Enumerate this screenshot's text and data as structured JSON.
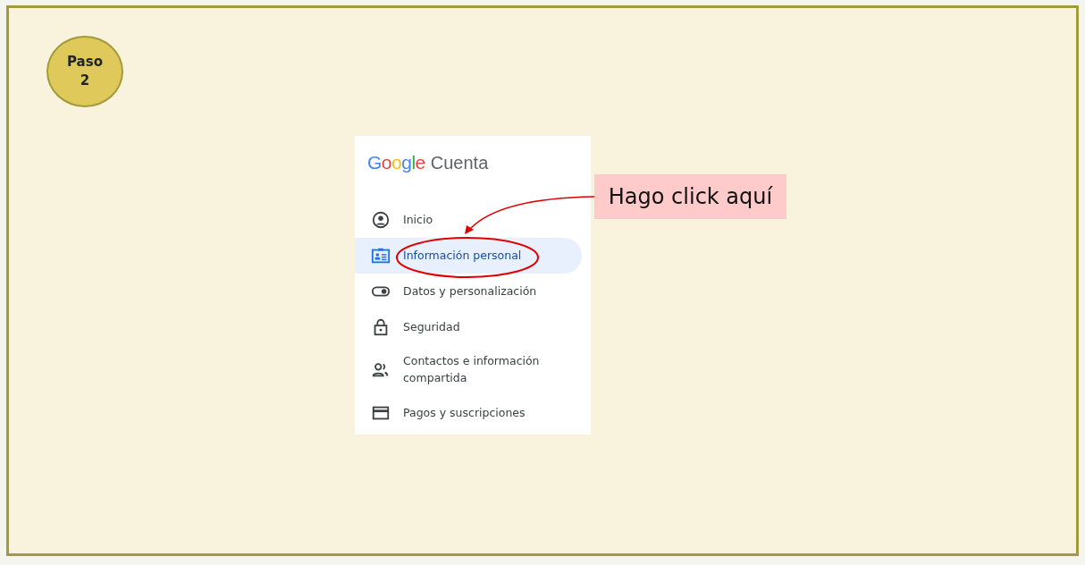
{
  "step": {
    "label": "Paso 2"
  },
  "account_panel": {
    "logo": "Google",
    "product": "Cuenta",
    "items": [
      {
        "label": "Inicio",
        "kind": "home",
        "selected": false
      },
      {
        "label": "Información personal",
        "kind": "person",
        "selected": true
      },
      {
        "label": "Datos y personalización",
        "kind": "toggle",
        "selected": false
      },
      {
        "label": "Seguridad",
        "kind": "lock",
        "selected": false
      },
      {
        "label": "Contactos e información compartida",
        "kind": "people",
        "selected": false
      },
      {
        "label": "Pagos y suscripciones",
        "kind": "card",
        "selected": false
      }
    ]
  },
  "callout": {
    "text": "Hago click aquí"
  }
}
